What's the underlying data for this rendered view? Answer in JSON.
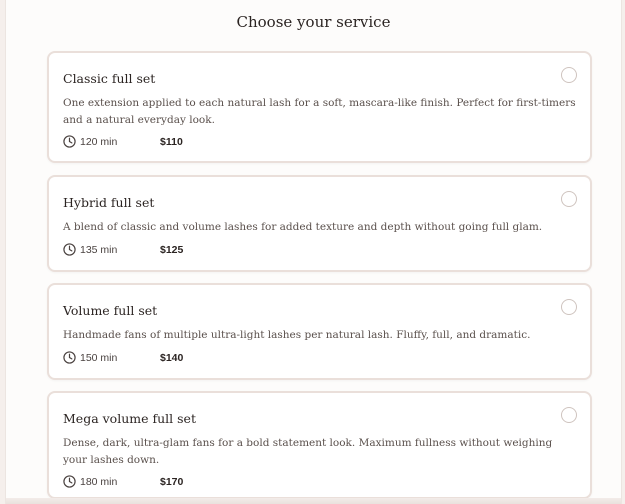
{
  "header": {
    "title": "Choose your service"
  },
  "services": [
    {
      "name": "Classic full set",
      "description": "One extension applied to each natural lash for a soft, mascara-like finish. Perfect for first-timers and a natural everyday look.",
      "duration": "120 min",
      "price": "$110"
    },
    {
      "name": "Hybrid full set",
      "description": "A blend of classic and volume lashes for added texture and depth without going full glam.",
      "duration": "135 min",
      "price": "$125"
    },
    {
      "name": "Volume full set",
      "description": "Handmade fans of multiple ultra-light lashes per natural lash. Fluffy, full, and dramatic.",
      "duration": "150 min",
      "price": "$140"
    },
    {
      "name": "Mega volume full set",
      "description": "Dense, dark, ultra-glam fans for a bold statement look. Maximum fullness without weighing your lashes down.",
      "duration": "180 min",
      "price": "$170"
    }
  ],
  "icons": {
    "duration": "clock-icon",
    "select": "radio-button"
  },
  "colors": {
    "card_border": "#eadfda",
    "background": "#fdfcfb"
  }
}
